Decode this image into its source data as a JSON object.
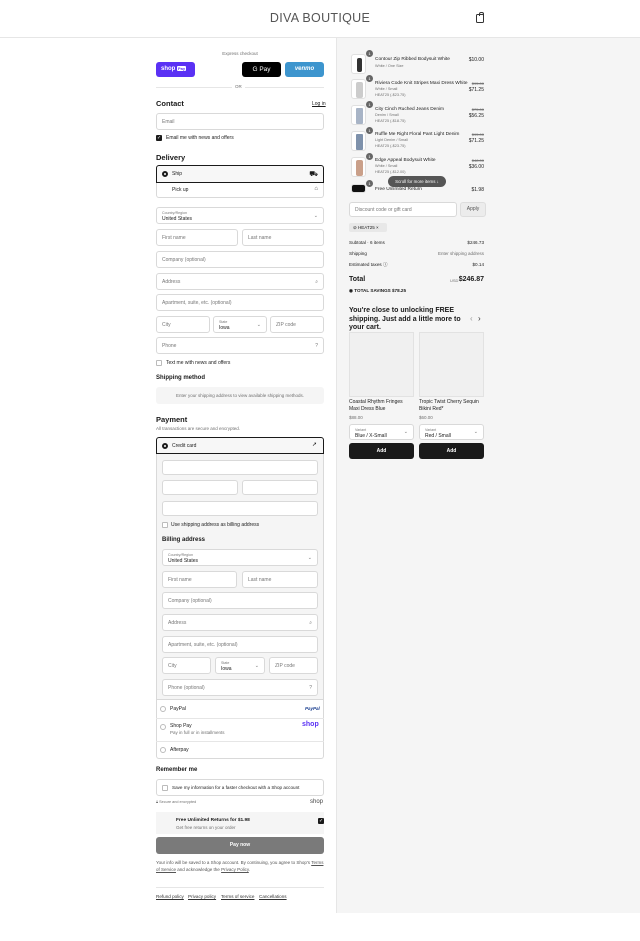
{
  "header": {
    "brand": "DIVA BOUTIQUE"
  },
  "express": {
    "label": "Express checkout",
    "shop_pay": "shop",
    "shop_pay_badge": "Pay",
    "google_pay": "G Pay",
    "venmo": "venmo",
    "or": "OR"
  },
  "contact": {
    "title": "Contact",
    "login": "Log in",
    "email_placeholder": "Email",
    "news_label": "Email me with news and offers"
  },
  "delivery": {
    "title": "Delivery",
    "ship": "Ship",
    "pickup": "Pick up",
    "country_label": "Country/Region",
    "country_value": "United States",
    "first_name": "First name",
    "last_name": "Last name",
    "company": "Company (optional)",
    "address": "Address",
    "apartment": "Apartment, suite, etc. (optional)",
    "city": "City",
    "state_label": "State",
    "state_value": "Iowa",
    "zip": "ZIP code",
    "phone": "Phone",
    "text_news": "Text me with news and offers"
  },
  "shipping": {
    "title": "Shipping method",
    "notice": "Enter your shipping address to view available shipping methods."
  },
  "payment": {
    "title": "Payment",
    "subtitle": "All transactions are secure and encrypted.",
    "credit_card": "Credit card",
    "same_address": "Use shipping address as billing address",
    "paypal": "PayPal",
    "paypal_logo": "PayPal",
    "shop_pay": "Shop Pay",
    "shop_pay_sub": "Pay in full or in installments",
    "shop_logo": "shop",
    "afterpay": "Afterpay"
  },
  "billing": {
    "title": "Billing address",
    "country_label": "Country/Region",
    "country_value": "United States",
    "first_name": "First name",
    "last_name": "Last name",
    "company": "Company (optional)",
    "address": "Address",
    "apartment": "Apartment, suite, etc. (optional)",
    "city": "City",
    "state_label": "State",
    "state_value": "Iowa",
    "zip": "ZIP code",
    "phone": "Phone (optional)"
  },
  "remember": {
    "title": "Remember me",
    "save_label": "Save my information for a faster checkout with a Shop account",
    "secure": "Secure and encrypted",
    "shop": "shop"
  },
  "returns": {
    "title": "Free Unlimited Returns for $1.98",
    "sub": "Get free returns on your order"
  },
  "pay_now": "Pay now",
  "legal": {
    "text1": "Your info will be saved to a Shop account. By continuing, you agree to Shop's",
    "terms": "Terms of Service",
    "text2": "and acknowledge the",
    "privacy": "Privacy Policy",
    "end": "."
  },
  "footer": {
    "refund": "Refund policy",
    "privacy": "Privacy policy",
    "terms": "Terms of service",
    "cancel": "Cancellations"
  },
  "cart": {
    "items": [
      {
        "qty": "1",
        "name": "Contour Zip Ribbed Bodysuit White",
        "sub": "White / One Size",
        "price": "$10.00"
      },
      {
        "qty": "1",
        "name": "Riviera Code Knit Stripes Maxi Dress White",
        "sub": "White / Small",
        "code": "HEAT25 (-$23.75)",
        "old": "$95.00",
        "price": "$71.25"
      },
      {
        "qty": "1",
        "name": "City Cinch Ruched Jeans Denim",
        "sub": "Denim / Small",
        "code": "HEAT25 (-$18.75)",
        "old": "$75.00",
        "price": "$56.25"
      },
      {
        "qty": "1",
        "name": "Ruffle Me Right Floral Pant Light Denim",
        "sub": "Light Denim / Small",
        "code": "HEAT25 (-$23.75)",
        "old": "$95.00",
        "price": "$71.25"
      },
      {
        "qty": "1",
        "name": "Edge Appeal Bodysuit White",
        "sub": "White / Small",
        "code": "HEAT25 (-$12.00)",
        "old": "$48.00",
        "price": "$36.00"
      },
      {
        "qty": "1",
        "name": "Free Unlimited Return",
        "price": "$1.98"
      }
    ],
    "scroll_hint": "Scroll for more items",
    "discount_placeholder": "Discount code or gift card",
    "apply": "Apply",
    "tag": "HEAT25",
    "subtotal_label": "Subtotal · 6 items",
    "subtotal": "$246.73",
    "shipping_label": "Shipping",
    "shipping_value": "Enter shipping address",
    "taxes_label": "Estimated taxes",
    "taxes": "$0.14",
    "total_label": "Total",
    "currency": "USD",
    "total": "$246.87",
    "savings": "TOTAL SAVINGS $78.25"
  },
  "upsell": {
    "title": "You're close to unlocking FREE shipping. Just add a little more to your cart.",
    "products": [
      {
        "name": "Coastal Rhythm Fringes Maxi Dress Blue",
        "price": "$88.00",
        "variant_label": "Variant",
        "variant": "Blue / X-Small",
        "add": "Add"
      },
      {
        "name": "Tropic Twist Cherry Sequin Bikini Red*",
        "price": "$60.00",
        "variant_label": "Variant",
        "variant": "Red / Small",
        "add": "Add"
      }
    ]
  },
  "colors": {
    "shop_pay": "#5a31f4",
    "venmo": "#3d95ce",
    "dark": "#1a1a1a",
    "pay_button": "#7a7a7a"
  }
}
